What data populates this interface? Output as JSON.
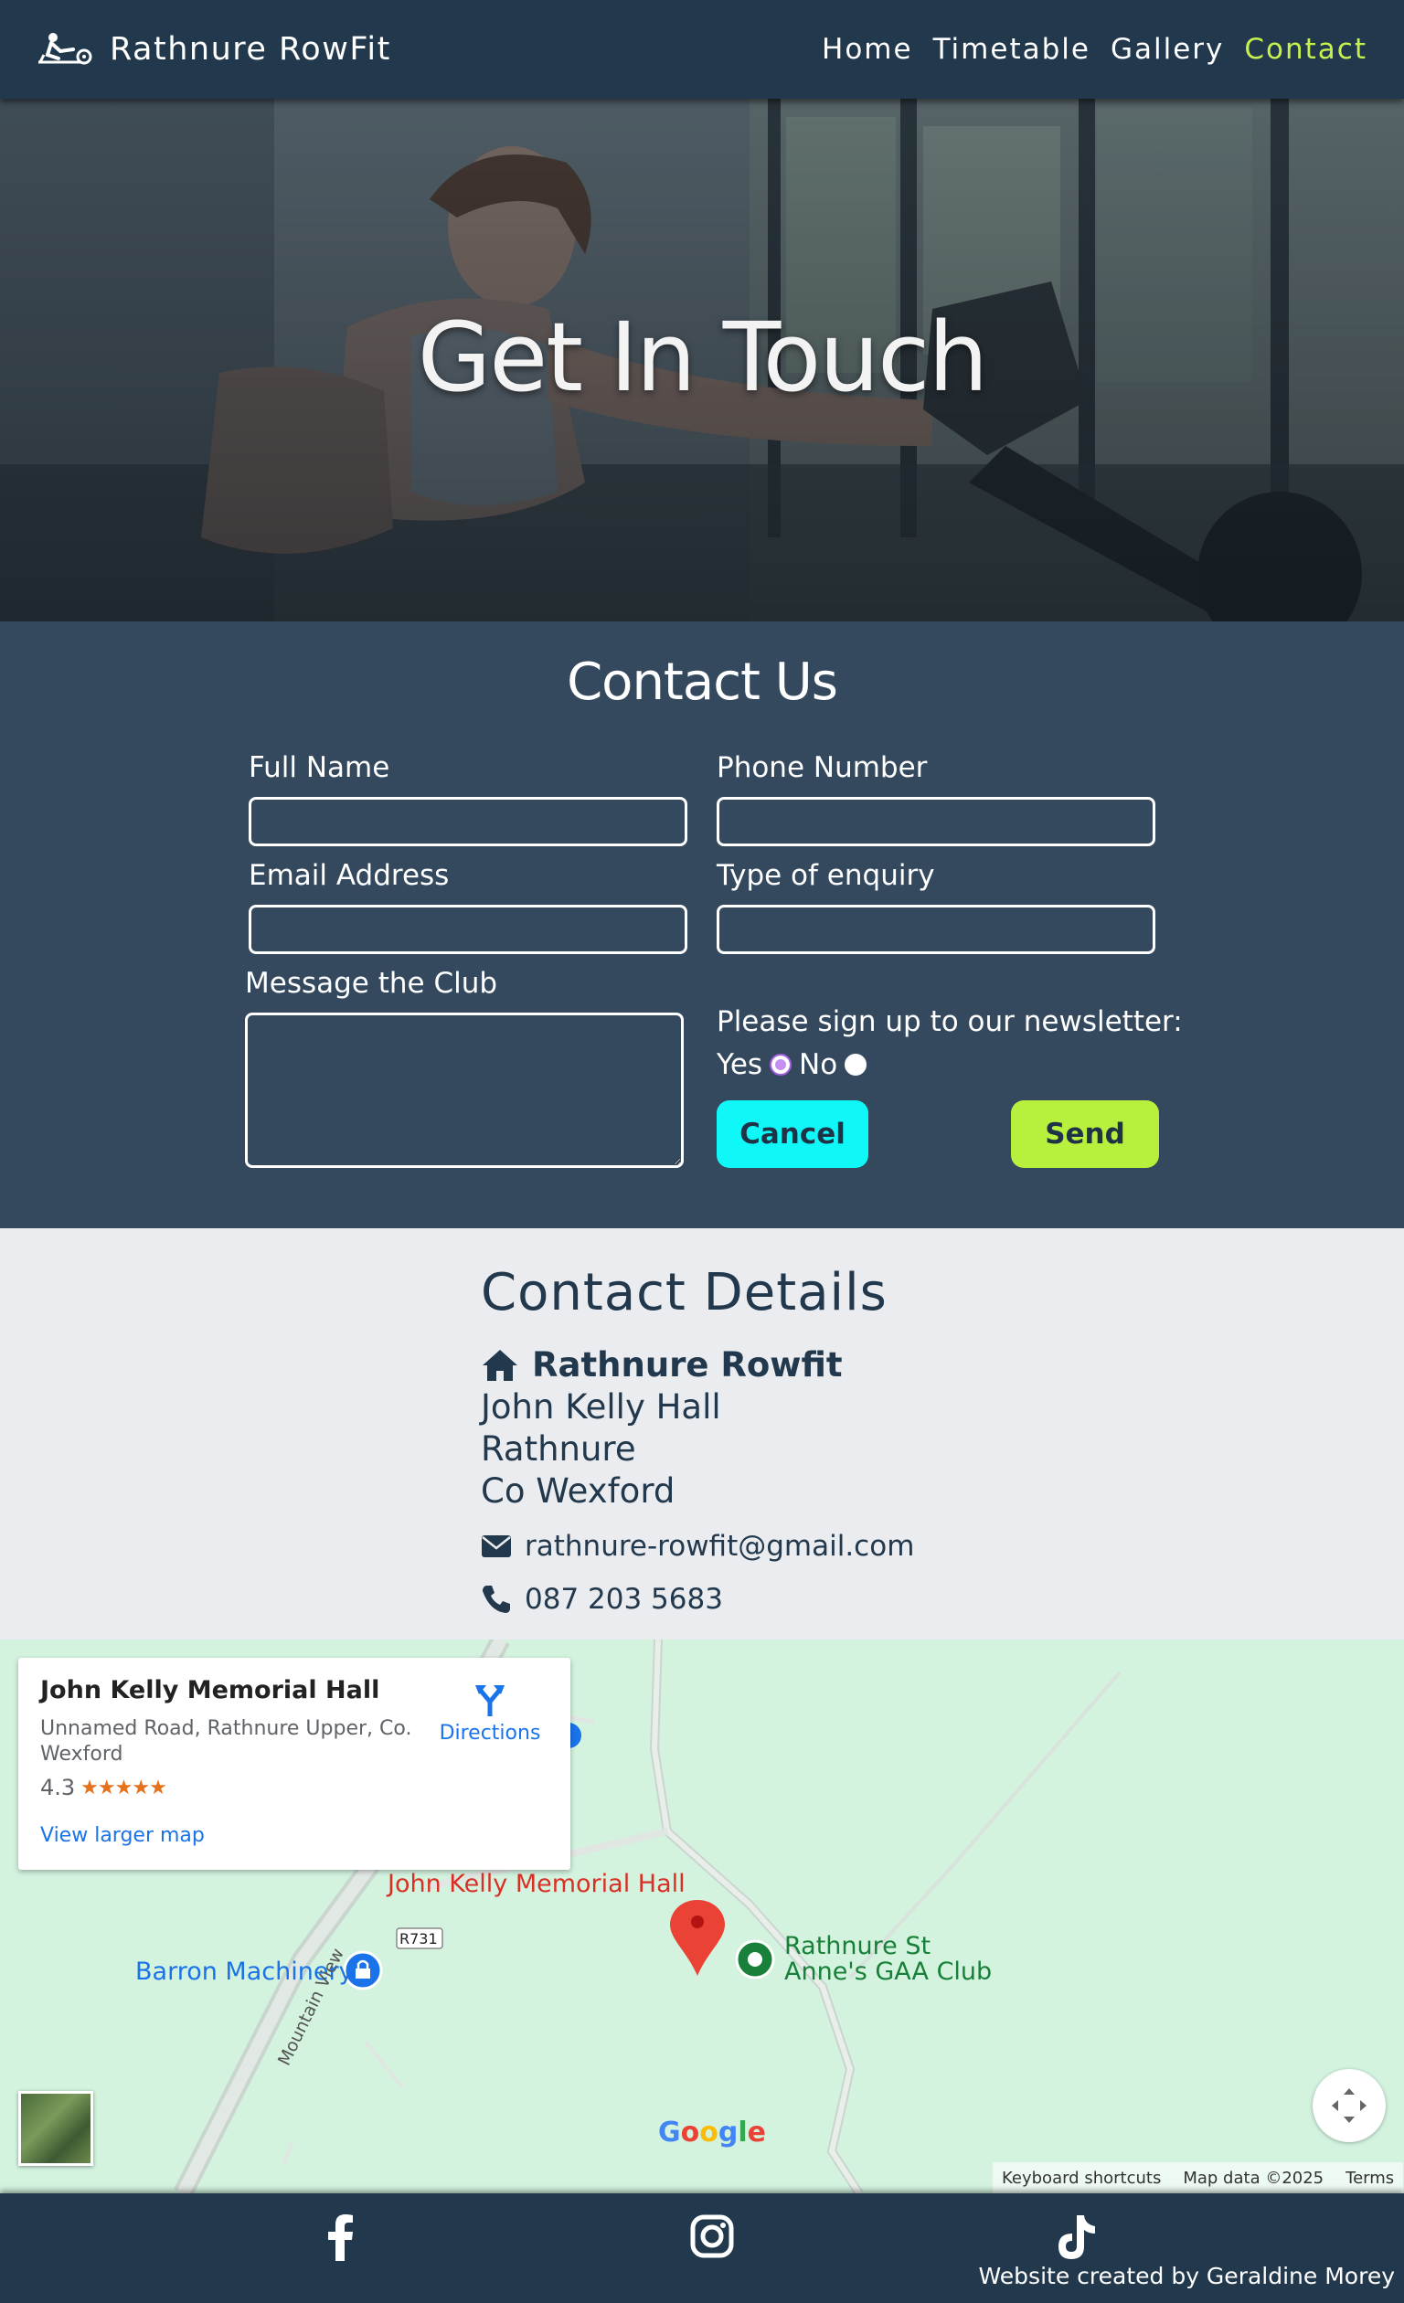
{
  "nav": {
    "brand": "Rathnure RowFit",
    "links": [
      {
        "label": "Home",
        "active": false
      },
      {
        "label": "Timetable",
        "active": false
      },
      {
        "label": "Gallery",
        "active": false
      },
      {
        "label": "Contact",
        "active": true
      }
    ],
    "active_color": "#c6f04e"
  },
  "hero": {
    "title": "Get In Touch"
  },
  "form": {
    "title": "Contact Us",
    "full_name_label": "Full Name",
    "full_name_value": "",
    "phone_label": "Phone Number",
    "phone_value": "",
    "email_label": "Email Address",
    "email_value": "",
    "enquiry_label": "Type of enquiry",
    "enquiry_value": "",
    "message_label": "Message the Club",
    "message_value": "",
    "newsletter_label": "Please sign up to our newsletter:",
    "yes_label": "Yes",
    "no_label": "No",
    "newsletter_selected": "Yes",
    "cancel_label": "Cancel",
    "send_label": "Send"
  },
  "details": {
    "title": "Contact Details",
    "name": "Rathnure Rowfit",
    "address": [
      "John Kelly Hall",
      "Rathnure",
      "Co Wexford"
    ],
    "email": "rathnure-rowfit@gmail.com",
    "phone": "087 203 5683"
  },
  "map": {
    "card_title": "John Kelly Memorial Hall",
    "card_address": "Unnamed Road, Rathnure Upper, Co. Wexford",
    "rating": "4.3",
    "stars": "★★★★★",
    "view_larger": "View larger map",
    "directions": "Directions",
    "pin_label": "John Kelly Memorial Hall",
    "road_label": "R731",
    "barron_label": "Barron Machinery",
    "gaa_label_1": "Rathnure St",
    "gaa_label_2": "Anne's GAA Club",
    "mountain_label": "Mountain View",
    "google_logo": "Google",
    "keyboard_shortcuts": "Keyboard shortcuts",
    "map_data": "Map data ©2025",
    "terms": "Terms"
  },
  "footer": {
    "icons": [
      "facebook-icon",
      "instagram-icon",
      "tiktok-icon"
    ],
    "credit": "Website created by Geraldine Morey"
  }
}
